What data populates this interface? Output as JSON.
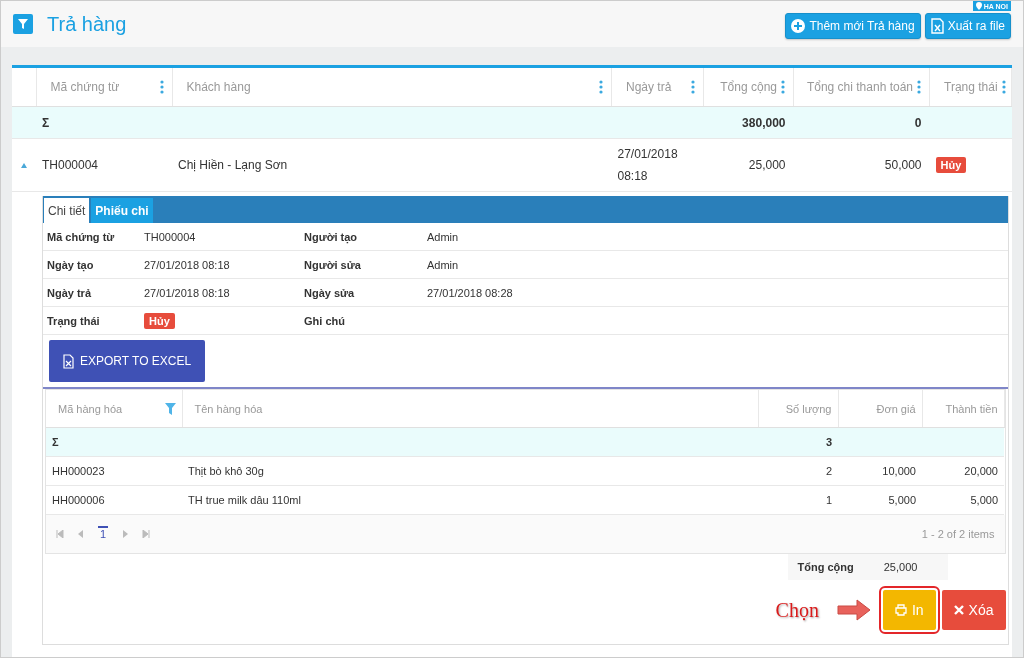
{
  "header": {
    "title": "Trả hàng",
    "location": "HA NOI",
    "buttons": [
      {
        "label": "Thêm mới Trả hàng",
        "kind": "add"
      },
      {
        "label": "Xuất ra file",
        "kind": "excel"
      }
    ]
  },
  "table": {
    "columns": [
      "Mã chứng từ",
      "Khách hàng",
      "Ngày trả",
      "Tổng cộng",
      "Tổng chi thanh toán",
      "Trạng thái"
    ],
    "summary": {
      "symbol": "Σ",
      "total": "380,000",
      "paid": "0"
    },
    "rows": [
      {
        "expanded": true,
        "code": "TH000004",
        "customer": "Chị Hiền - Lạng Sơn",
        "date": "27/01/2018",
        "time": "08:18",
        "total": "25,000",
        "paid": "50,000",
        "status": "Hủy"
      }
    ]
  },
  "detail": {
    "tabs": [
      {
        "label": "Chi tiết",
        "selected": true
      },
      {
        "label": "Phiếu chi",
        "selected": false
      }
    ],
    "info": [
      [
        {
          "label": "Mã chứng từ",
          "value": "TH000004",
          "kind": "text"
        },
        {
          "label": "Người tạo",
          "value": "Admin",
          "kind": "text"
        }
      ],
      [
        {
          "label": "Ngày tạo",
          "value": "27/01/2018 08:18",
          "kind": "text"
        },
        {
          "label": "Người sửa",
          "value": "Admin",
          "kind": "text"
        }
      ],
      [
        {
          "label": "Ngày trả",
          "value": "27/01/2018 08:18",
          "kind": "text"
        },
        {
          "label": "Ngày sửa",
          "value": "27/01/2018 08:28",
          "kind": "text"
        }
      ],
      [
        {
          "label": "Trạng thái",
          "value": "Hủy",
          "kind": "badge"
        },
        {
          "label": "Ghi chú",
          "kind": "text"
        }
      ]
    ],
    "export_button": "EXPORT TO EXCEL",
    "items": {
      "columns": [
        "Mã hàng hóa",
        "Tên hàng hóa",
        "Số lượng",
        "Đơn giá",
        "Thành tiền"
      ],
      "summary": {
        "symbol": "Σ",
        "quantity": "3"
      },
      "rows": [
        [
          "HH000023",
          "Thịt bò khô 30g",
          "2",
          "10,000",
          "20,000"
        ],
        [
          "HH000006",
          "TH true milk dâu 110ml",
          "1",
          "5,000",
          "5,000"
        ]
      ],
      "pager": {
        "pages": [
          {
            "label": "1",
            "selected": true
          }
        ],
        "info": "1 - 2 of 2 items"
      }
    },
    "total": {
      "label": "Tổng cộng",
      "value": "25,000"
    },
    "annotation": "Chọn",
    "actions": [
      {
        "label": "In",
        "kind": "print",
        "highlighted": true
      },
      {
        "label": "Xóa",
        "kind": "delete",
        "highlighted": false
      }
    ]
  }
}
